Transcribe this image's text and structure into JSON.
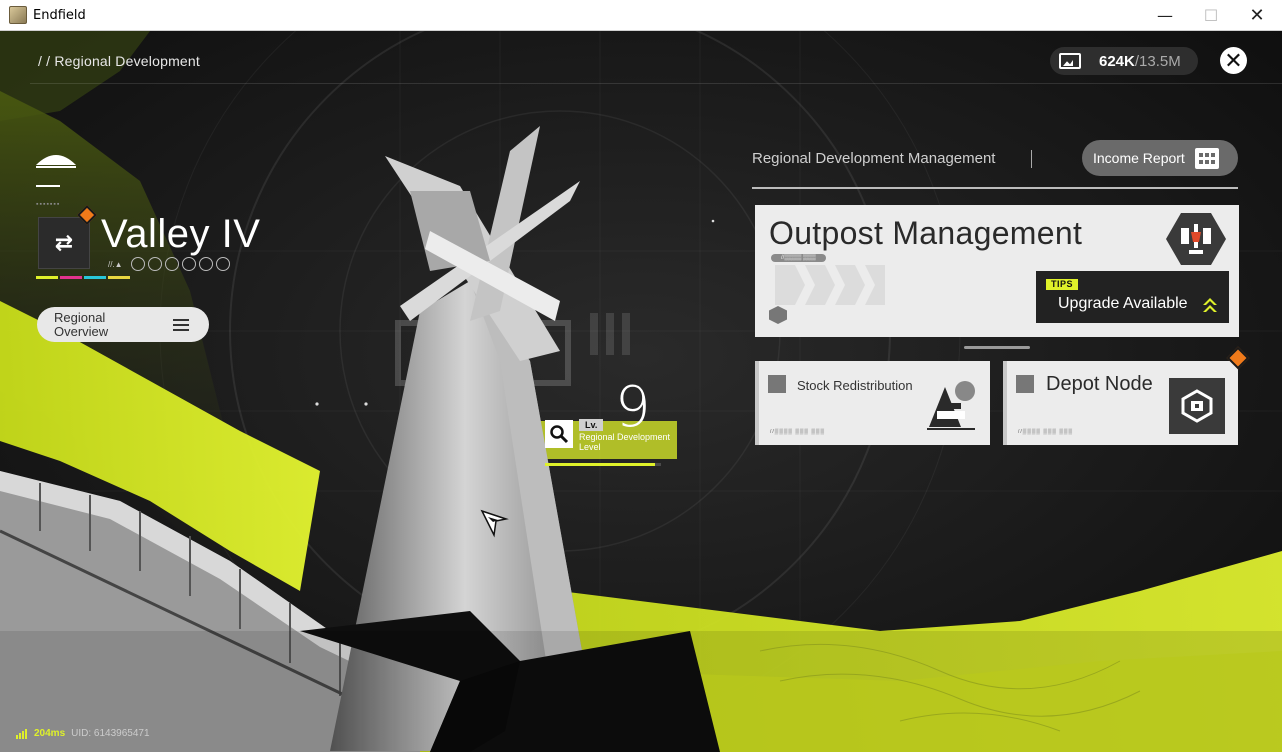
{
  "window": {
    "title": "Endfield",
    "minimize": "—",
    "maximize": "☐",
    "close": "✕"
  },
  "header": {
    "breadcrumb": "/ / Regional Development",
    "currency_current": "624K",
    "currency_max": "/13.5M",
    "close_glyph": "✕"
  },
  "region": {
    "name": "Valley IV",
    "icon_glyph": "⇄",
    "sub_code": "//.▲",
    "rings": 6,
    "color_bars": [
      "#dff12a",
      "#e2338d",
      "#29c6d9",
      "#e8d640"
    ]
  },
  "overview_button": {
    "label": "Regional Overview"
  },
  "level": {
    "lv": "Lv.",
    "caption": "Regional Development Level",
    "value": "9",
    "progress": 0.95
  },
  "panel": {
    "title": "Regional Development Management",
    "income_report": "Income Report",
    "outpost": {
      "title": "Outpost Management",
      "code": "//▒▒▒▒ ▒▒▒",
      "tips_tag": "TIPS",
      "tips_text": "Upgrade Available"
    },
    "stock": {
      "label": "Stock Redistribution",
      "code": "//▒▒▒▒ ▒▒▒ ▒▒▒"
    },
    "depot": {
      "label": "Depot Node",
      "code": "//▒▒▒▒ ▒▒▒ ▒▒▒"
    }
  },
  "status": {
    "ping": "204ms",
    "uid": "UID: 6143965471"
  },
  "colors": {
    "accent": "#dff12a",
    "badge": "#f07a1a",
    "card": "#ececec"
  }
}
